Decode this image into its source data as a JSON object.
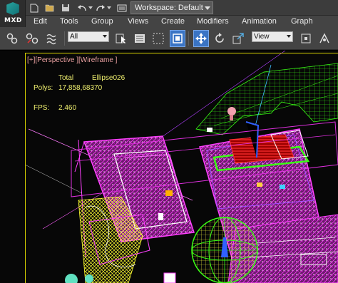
{
  "app": {
    "logo_text": "MXD",
    "workspace_label": "Workspace: Default"
  },
  "menu": [
    "Edit",
    "Tools",
    "Group",
    "Views",
    "Create",
    "Modifiers",
    "Animation",
    "Graph Editors"
  ],
  "toolbar": {
    "selection_filter": "All",
    "reference_coord": "View"
  },
  "viewport": {
    "label_plus": "[+]",
    "label_view": "[Perspective ]",
    "label_shading": "[Wireframe ]",
    "stats": {
      "col1_header": "Total",
      "col2_header": "Ellipse026",
      "polys_label": "Polys:",
      "polys_value": "17,858,68370",
      "fps_label": "FPS:",
      "fps_value": "2.460"
    }
  },
  "colors": {
    "wire_magenta": "#e030e0",
    "wire_green": "#39ff14",
    "wire_yellow": "#ffff30",
    "wire_red": "#ff2020",
    "wire_white": "#ffffff",
    "wire_blue": "#3060ff",
    "active_tool": "#3a74c4"
  }
}
